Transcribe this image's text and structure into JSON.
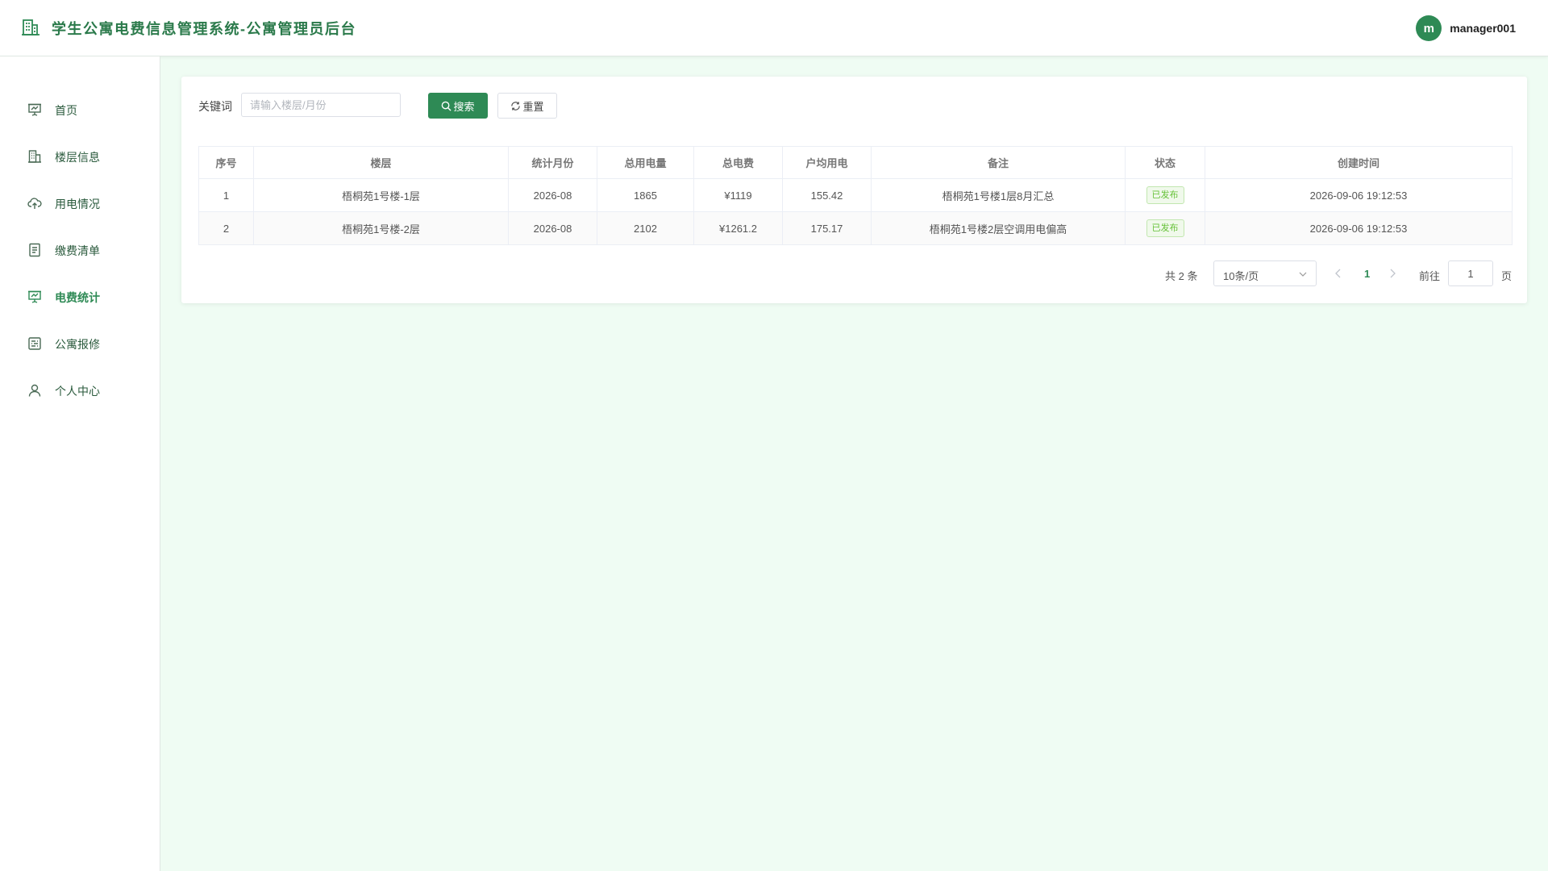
{
  "header": {
    "title": "学生公寓电费信息管理系统-公寓管理员后台",
    "user": {
      "avatar_letter": "m",
      "name": "manager001"
    }
  },
  "sidebar": {
    "items": [
      {
        "label": "首页",
        "icon": "dashboard-icon"
      },
      {
        "label": "楼层信息",
        "icon": "building-icon"
      },
      {
        "label": "用电情况",
        "icon": "cloud-upload-icon"
      },
      {
        "label": "缴费清单",
        "icon": "document-icon"
      },
      {
        "label": "电费统计",
        "icon": "chart-board-icon",
        "active": true
      },
      {
        "label": "公寓报修",
        "icon": "repair-icon"
      },
      {
        "label": "个人中心",
        "icon": "user-icon"
      }
    ]
  },
  "search": {
    "label": "关键词",
    "placeholder": "请输入楼层/月份",
    "value": "",
    "search_label": "搜索",
    "reset_label": "重置"
  },
  "table": {
    "columns": [
      "序号",
      "楼层",
      "统计月份",
      "总用电量",
      "总电费",
      "户均用电",
      "备注",
      "状态",
      "创建时间"
    ],
    "rows": [
      [
        "1",
        "梧桐苑1号楼-1层",
        "2026-08",
        "1865",
        "¥1119",
        "155.42",
        "梧桐苑1号楼1层8月汇总",
        "已发布",
        "2026-09-06 19:12:53"
      ],
      [
        "2",
        "梧桐苑1号楼-2层",
        "2026-08",
        "2102",
        "¥1261.2",
        "175.17",
        "梧桐苑1号楼2层空调用电偏高",
        "已发布",
        "2026-09-06 19:12:53"
      ]
    ]
  },
  "pagination": {
    "total_text": "共 2 条",
    "page_size": "10条/页",
    "current_page": "1",
    "goto_label": "前往",
    "goto_value": "1",
    "page_unit": "页"
  },
  "colors": {
    "brand": "#2e8a55",
    "background": "#effcf3",
    "status_published": "#67c23a"
  }
}
